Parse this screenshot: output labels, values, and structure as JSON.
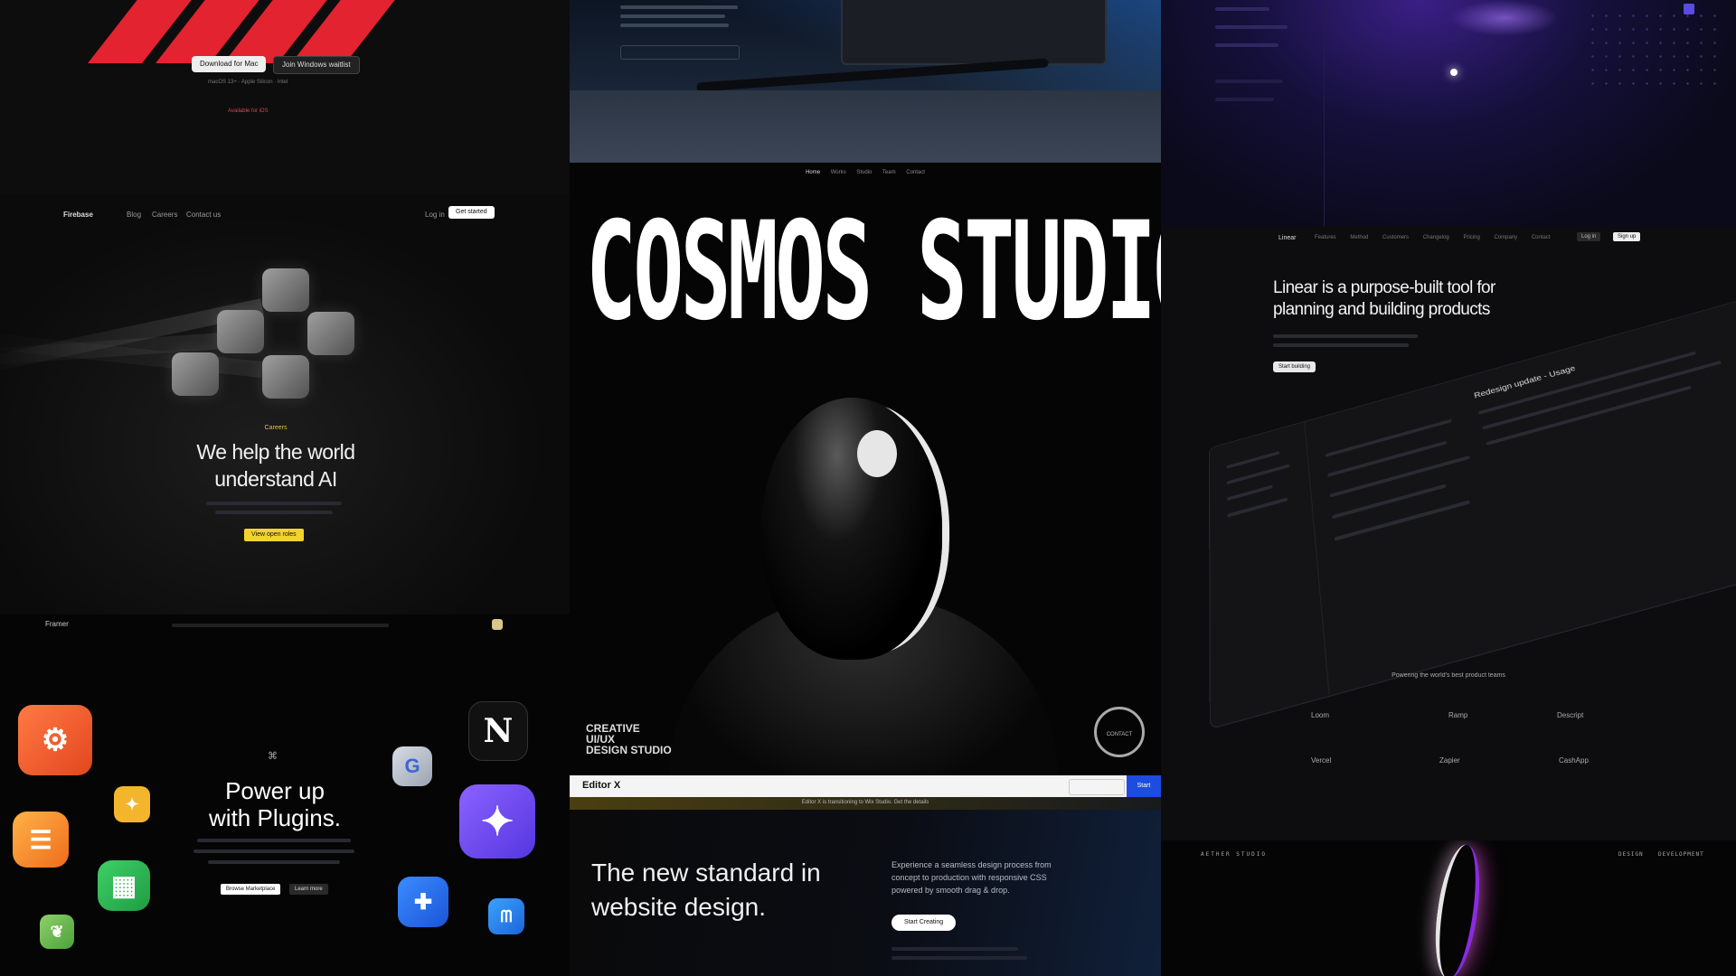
{
  "topleft": {
    "btn_left": "Download for Mac",
    "btn_right": "Join Windows waitlist",
    "sub": "macOS 13+ · Apple Silicon · Intel",
    "available": "Available for iOS"
  },
  "ai": {
    "brand": "Firebase",
    "nav": [
      "Blog",
      "Careers",
      "Contact us"
    ],
    "login": "Log in",
    "cta_nav": "Get started",
    "eyebrow": "Careers",
    "headline_1": "We help the world",
    "headline_2": "understand AI",
    "cta": "View open roles"
  },
  "plugins": {
    "brand": "Framer",
    "headline_1": "Power up",
    "headline_2": "with Plugins.",
    "btn_primary": "Browse Marketplace",
    "btn_secondary": "Learn more"
  },
  "cosmos": {
    "nav": [
      "Home",
      "Works",
      "Studio",
      "Team",
      "Contact"
    ],
    "title": "COSMOS STUDIO",
    "tagline_1": "CREATIVE",
    "tagline_2": "UI/UX",
    "tagline_3": "DESIGN STUDIO",
    "badge": "CONTACT",
    "editor_label": "Editor X",
    "editor_btn": "Start",
    "editor_sub": "Editor X is transitioning to Wix Studio. Get the details"
  },
  "newstd": {
    "headline_1": "The new standard in",
    "headline_2": "website design.",
    "desc_1": "Experience a seamless design process from",
    "desc_2": "concept to production with responsive CSS",
    "desc_3": "powered by smooth drag & drop.",
    "cta": "Start Creating"
  },
  "linear": {
    "brand": "Linear",
    "nav": [
      "Features",
      "Method",
      "Customers",
      "Changelog",
      "Pricing",
      "Company",
      "Contact"
    ],
    "login": "Log in",
    "signup": "Sign up",
    "headline_1": "Linear is a purpose-built tool for",
    "headline_2": "planning and building products",
    "cta": "Start building",
    "issue_title": "Redesign update - Usage",
    "powering": "Powering the world's best product teams",
    "logos": [
      "Loom",
      "Ramp",
      "Descript",
      "Vercel",
      "Zapier",
      "CashApp"
    ]
  },
  "bottomright": {
    "left_label": "AETHER STUDIO",
    "right_1": "DESIGN",
    "right_2": "DEVELOPMENT"
  },
  "colors": {
    "stripe": "#e3232f",
    "ai_cta": "#f1d330",
    "linear_bg": "#0d0d0f",
    "plugin_purple": "#6a45ec",
    "editor_blue": "#1e4be0"
  },
  "icons": [
    "hubspot-icon",
    "firebase-icon",
    "sheets-icon",
    "leaf-icon",
    "notion-icon",
    "google-icon",
    "sparkle-icon",
    "apps-icon",
    "monday-icon"
  ]
}
